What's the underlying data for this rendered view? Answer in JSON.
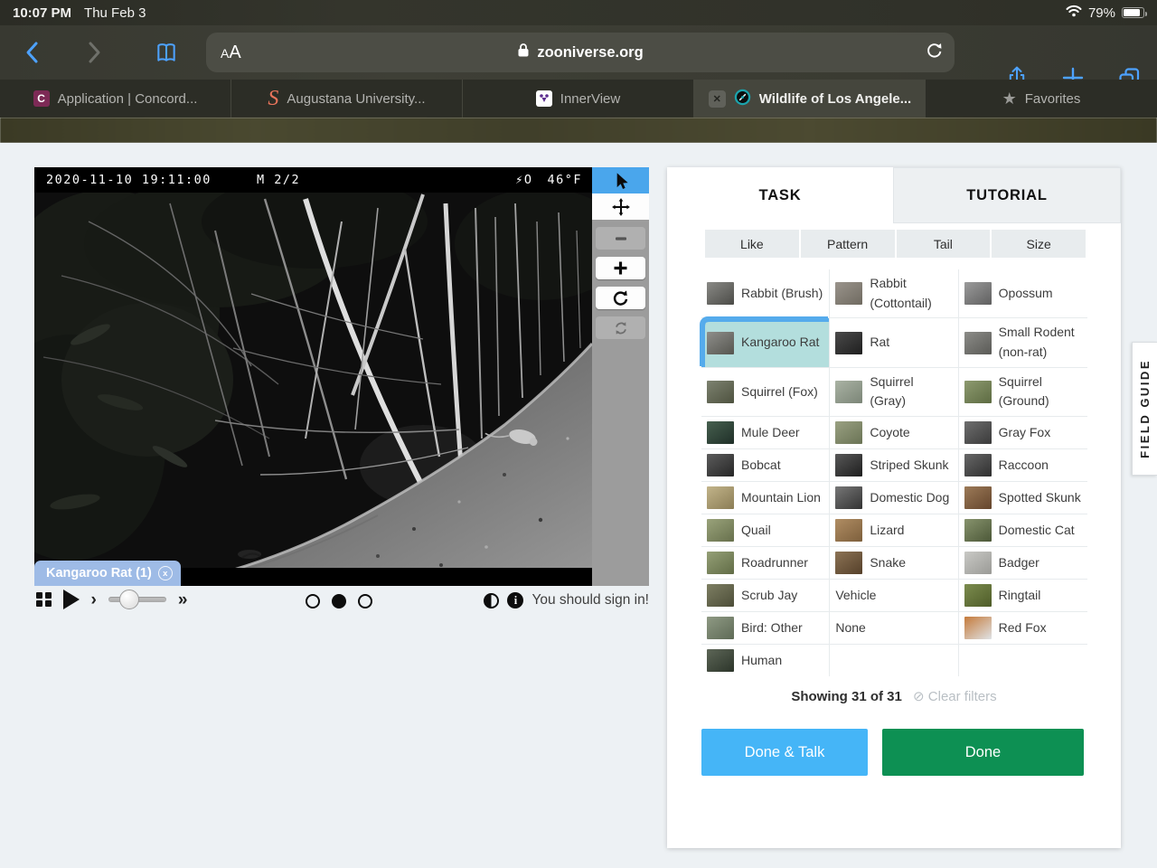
{
  "status_bar": {
    "time": "10:07 PM",
    "date": "Thu Feb 3",
    "battery_percent": "79%"
  },
  "browser": {
    "reader_label_small": "A",
    "reader_label_big": "A",
    "url": "zooniverse.org",
    "tabs": [
      {
        "label": "Application | Concord...",
        "icon": "c-badge",
        "active": false
      },
      {
        "label": "Augustana University...",
        "icon": "script-s",
        "active": false
      },
      {
        "label": "InnerView",
        "icon": "innerview-logo",
        "active": false
      },
      {
        "label": "Wildlife of Los Angele...",
        "icon": "zooniverse-compass",
        "active": true,
        "closable": true
      },
      {
        "label": "Favorites",
        "icon": "star",
        "active": false
      }
    ]
  },
  "viewer": {
    "overlay": {
      "datetime": "2020-11-10 19:11:00",
      "frame": "M 2/2",
      "flash": "⚡O",
      "temperature": "46°F"
    },
    "annotation_label": "Kangaroo Rat (1)",
    "pill_close": "x",
    "pagination": {
      "count": 3,
      "active_index": 1
    },
    "signin_message": "You should sign in!"
  },
  "task_panel": {
    "tabs": {
      "task": "TASK",
      "tutorial": "TUTORIAL"
    },
    "filters": [
      "Like",
      "Pattern",
      "Tail",
      "Size"
    ],
    "animals": [
      {
        "label": "Rabbit (Brush)",
        "thumb": [
          "#8a8a86",
          "#4b4b47"
        ]
      },
      {
        "label": "Rabbit (Cottontail)",
        "thumb": [
          "#9a948c",
          "#6f6a60"
        ]
      },
      {
        "label": "Opossum",
        "thumb": [
          "#9b9b9b",
          "#5f5f5f"
        ]
      },
      {
        "label": "Kangaroo Rat",
        "thumb": [
          "#8f8f8b",
          "#55554f"
        ],
        "selected": true
      },
      {
        "label": "Rat",
        "thumb": [
          "#4a4a4a",
          "#1f1f1f"
        ]
      },
      {
        "label": "Small Rodent (non-rat)",
        "thumb": [
          "#8c8c88",
          "#5a5a56"
        ]
      },
      {
        "label": "Squirrel (Fox)",
        "thumb": [
          "#7d8270",
          "#4e523f"
        ]
      },
      {
        "label": "Squirrel (Gray)",
        "thumb": [
          "#aab3a4",
          "#7b8577"
        ]
      },
      {
        "label": "Squirrel (Ground)",
        "thumb": [
          "#8d9a6f",
          "#5d6b42"
        ]
      },
      {
        "label": "Mule Deer",
        "thumb": [
          "#47604f",
          "#1f2f28"
        ]
      },
      {
        "label": "Coyote",
        "thumb": [
          "#9aa182",
          "#6a7355"
        ]
      },
      {
        "label": "Gray Fox",
        "thumb": [
          "#6e6e6e",
          "#3a3a3a"
        ]
      },
      {
        "label": "Bobcat",
        "thumb": [
          "#5c5c5c",
          "#262626"
        ]
      },
      {
        "label": "Striped Skunk",
        "thumb": [
          "#585858",
          "#1e1e1e"
        ]
      },
      {
        "label": "Raccoon",
        "thumb": [
          "#676767",
          "#2f2f2f"
        ]
      },
      {
        "label": "Mountain Lion",
        "thumb": [
          "#c2b48a",
          "#8b7d55"
        ]
      },
      {
        "label": "Domestic Dog",
        "thumb": [
          "#777777",
          "#333333"
        ]
      },
      {
        "label": "Spotted Skunk",
        "thumb": [
          "#9c7a58",
          "#64452c"
        ]
      },
      {
        "label": "Quail",
        "thumb": [
          "#9aa37b",
          "#67704c"
        ]
      },
      {
        "label": "Lizard",
        "thumb": [
          "#b08d63",
          "#7d5f3c"
        ]
      },
      {
        "label": "Domestic Cat",
        "thumb": [
          "#87936d",
          "#4c5838"
        ]
      },
      {
        "label": "Roadrunner",
        "thumb": [
          "#95a077",
          "#616c46"
        ]
      },
      {
        "label": "Snake",
        "thumb": [
          "#8c7355",
          "#55402a"
        ]
      },
      {
        "label": "Badger",
        "thumb": [
          "#c9c9c5",
          "#9a9a96"
        ]
      },
      {
        "label": "Scrub Jay",
        "thumb": [
          "#7e7f63",
          "#4c4d38"
        ]
      },
      {
        "label": "Vehicle",
        "thumb": null
      },
      {
        "label": "Ringtail",
        "thumb": [
          "#7c8c4f",
          "#4e5c28"
        ]
      },
      {
        "label": "Bird: Other",
        "thumb": [
          "#8f9a84",
          "#5e6a56"
        ]
      },
      {
        "label": "None",
        "thumb": null
      },
      {
        "label": "Red Fox",
        "thumb": [
          "#c57a3a",
          "#dfe3e6"
        ]
      },
      {
        "label": "Human",
        "thumb": [
          "#5d6657",
          "#2c352a"
        ]
      }
    ],
    "showing": "Showing 31 of 31",
    "clear_filters_icon": "⊘",
    "clear_filters": "Clear filters",
    "done_talk_label": "Done & Talk",
    "done_label": "Done"
  },
  "field_guide_label": "FIELD GUIDE",
  "colors": {
    "accent_blue": "#4aa6ec",
    "selected_teal": "#b3dedd",
    "done_green": "#0d9053",
    "done_talk_blue": "#45b5f7",
    "annotation_pill_blue": "#a7c5f2",
    "safari_blue": "#4da2ff"
  }
}
